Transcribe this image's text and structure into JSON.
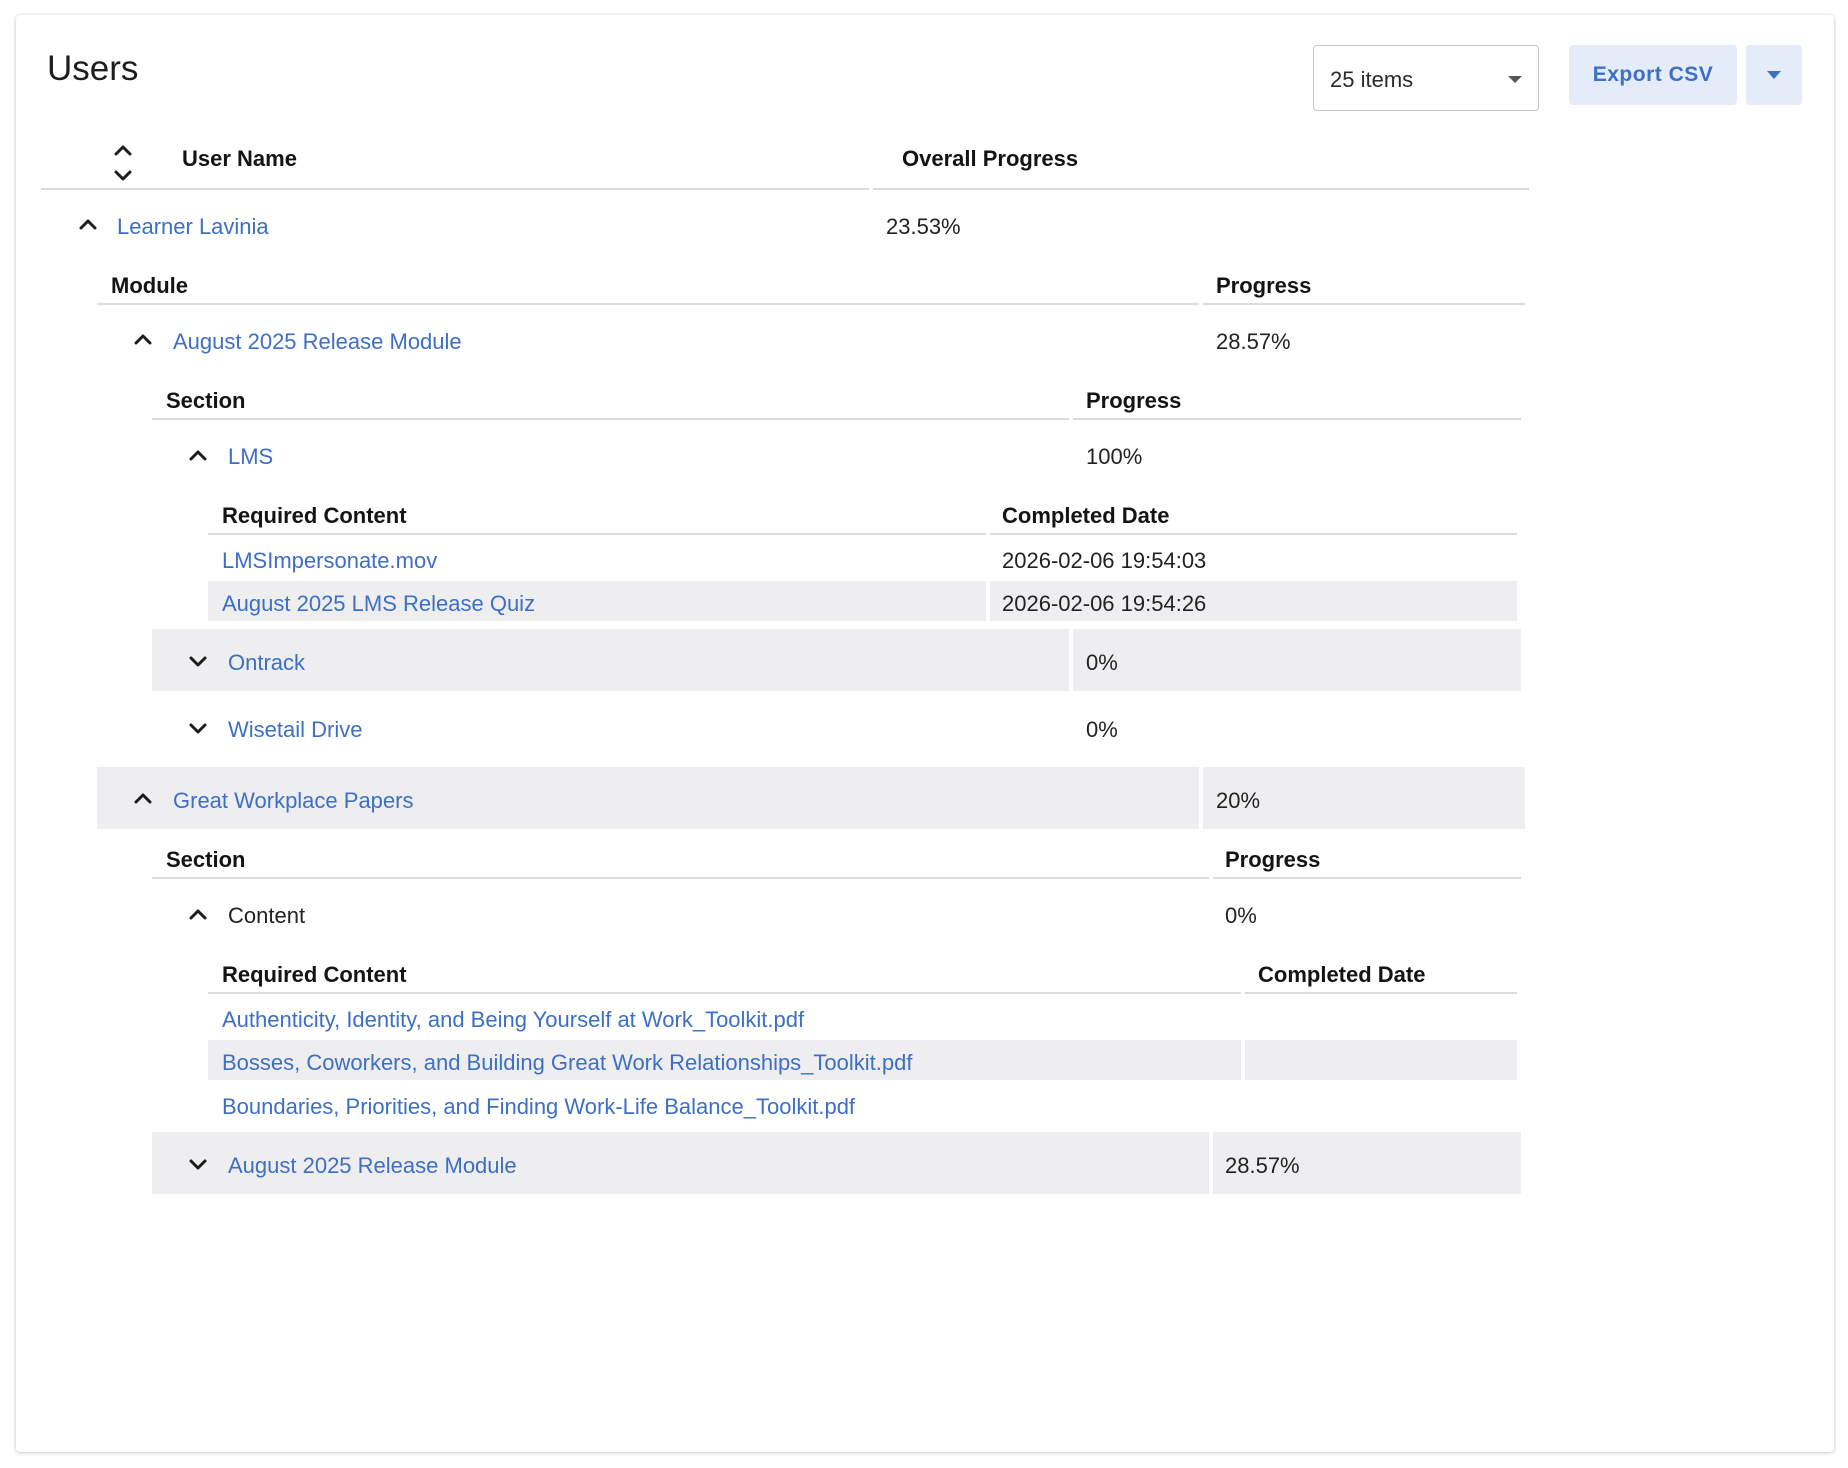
{
  "page": {
    "title": "Users"
  },
  "toolbar": {
    "items_select": "25 items",
    "export_label": "Export CSV"
  },
  "users_table": {
    "col_user": "User Name",
    "col_progress": "Overall Progress"
  },
  "user": {
    "name": "Learner Lavinia",
    "progress": "23.53%"
  },
  "modules_table": {
    "col_module": "Module",
    "col_progress": "Progress"
  },
  "module1": {
    "name": "August 2025 Release Module",
    "progress": "28.57%",
    "sections_header": {
      "col_section": "Section",
      "col_progress": "Progress"
    },
    "section_lms": {
      "name": "LMS",
      "progress": "100%",
      "content_header": {
        "col_content": "Required Content",
        "col_date": "Completed Date"
      },
      "items": [
        {
          "name": "LMSImpersonate.mov",
          "date": "2026-02-06 19:54:03"
        },
        {
          "name": "August 2025 LMS Release Quiz",
          "date": "2026-02-06 19:54:26"
        }
      ]
    },
    "section_ontrack": {
      "name": "Ontrack",
      "progress": "0%"
    },
    "section_wisetail": {
      "name": "Wisetail Drive",
      "progress": "0%"
    }
  },
  "module2": {
    "name": "Great Workplace Papers",
    "progress": "20%",
    "sections_header": {
      "col_section": "Section",
      "col_progress": "Progress"
    },
    "section_content": {
      "name": "Content",
      "progress": "0%",
      "content_header": {
        "col_content": "Required Content",
        "col_date": "Completed Date"
      },
      "items": [
        {
          "name": "Authenticity, Identity, and Being Yourself at Work_Toolkit.pdf",
          "date": ""
        },
        {
          "name": "Bosses, Coworkers, and Building Great Work Relationships_Toolkit.pdf",
          "date": ""
        },
        {
          "name": "Boundaries, Priorities, and Finding Work-Life Balance_Toolkit.pdf",
          "date": ""
        }
      ]
    },
    "section_aug": {
      "name": "August 2025 Release Module",
      "progress": "28.57%"
    }
  },
  "colors": {
    "link": "#3d6fc4",
    "stripe": "#eeeef1",
    "button_bg": "#e3ecf8"
  }
}
